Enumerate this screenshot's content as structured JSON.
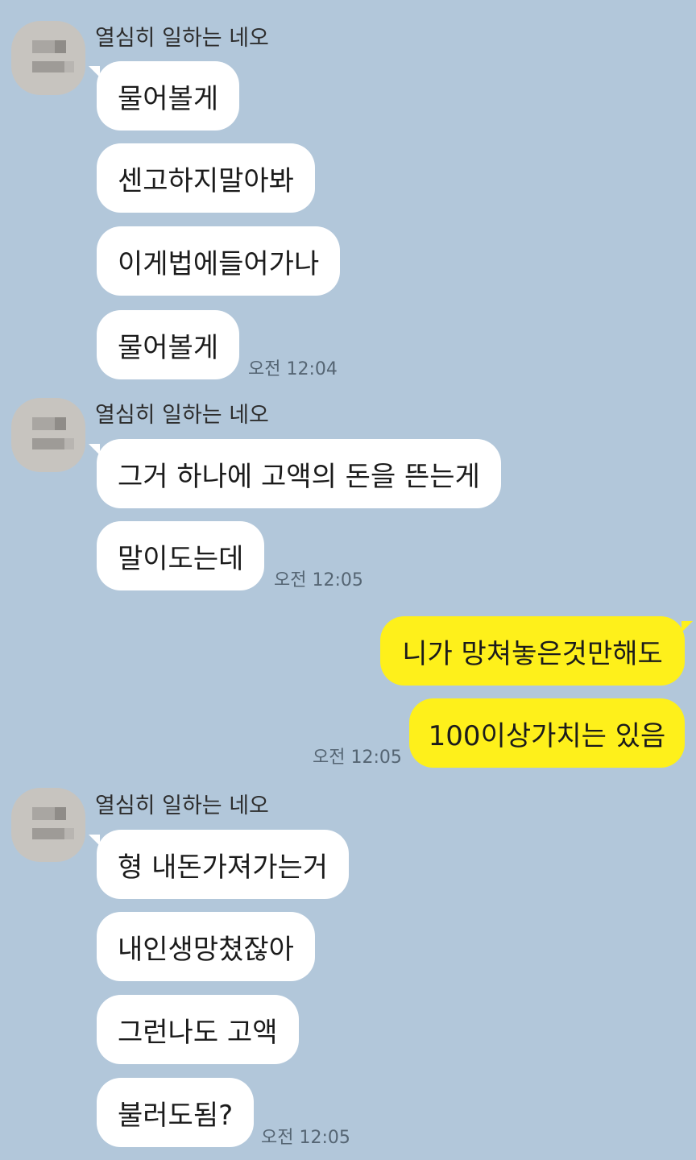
{
  "groups": [
    {
      "sender": "열심히 일하는 네오",
      "messages": [
        "물어볼게",
        "센고하지말아봐",
        "이게법에들어가나",
        "물어볼게"
      ],
      "time": "오전 12:04"
    },
    {
      "sender": "열심히 일하는 네오",
      "messages": [
        "그거 하나에 고액의 돈을 뜬는게",
        "말이도는데"
      ],
      "time": "오전 12:05"
    },
    {
      "sender": "me",
      "messages": [
        "니가 망쳐놓은것만해도",
        "100이상가치는 있음"
      ],
      "time": "오전 12:05"
    },
    {
      "sender": "열심히 일하는 네오",
      "messages": [
        "형 내돈가져가는거",
        "내인생망쳤잖아",
        "그런나도 고액",
        "불러도됨?"
      ],
      "time": "오전 12:05"
    }
  ],
  "colors": {
    "background": "#b2c7da",
    "incoming_bubble": "#ffffff",
    "outgoing_bubble": "#fef01b",
    "timestamp": "#556573"
  },
  "icons": {
    "avatar": "pixelated-profile-photo"
  }
}
